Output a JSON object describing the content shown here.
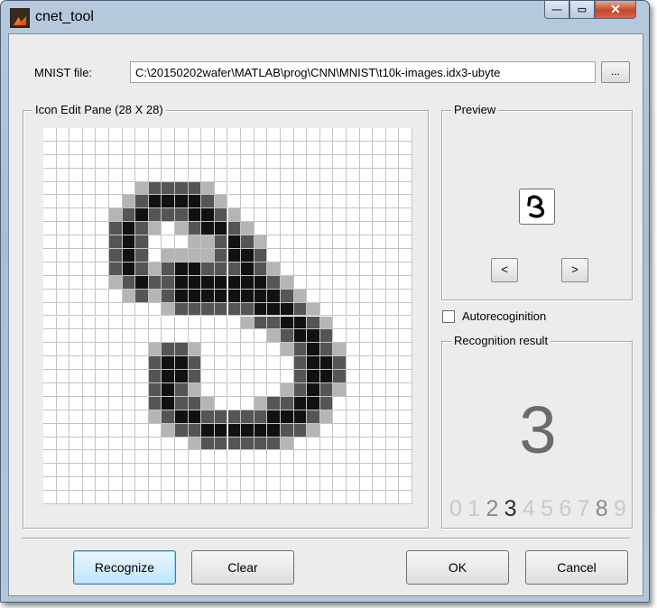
{
  "window": {
    "title": "cnet_tool"
  },
  "file": {
    "label": "MNIST file:",
    "path": "C:\\20150202wafer\\MATLAB\\prog\\CNN\\MNIST\\t10k-images.idx3-ubyte",
    "browse_label": "..."
  },
  "edit_pane": {
    "title": "Icon Edit Pane (28 X 28)",
    "rows": 28,
    "cols": 28,
    "cells": [
      "",
      "",
      "",
      "",
      "",
      "",
      "",
      "",
      "",
      "",
      "",
      "",
      "",
      "",
      "",
      "",
      "",
      "",
      "",
      "",
      "",
      "",
      "",
      "",
      "",
      "",
      "",
      ""
    ],
    "ink": [
      [
        4,
        12,
        5,
        14
      ],
      [
        5,
        11,
        6,
        13
      ],
      [
        6,
        10,
        7,
        13
      ],
      [
        7,
        10,
        8,
        18
      ],
      [
        8,
        9,
        9,
        17
      ],
      [
        9,
        9,
        10,
        19
      ],
      [
        10,
        9,
        11,
        19
      ],
      [
        11,
        9,
        12,
        20
      ],
      [
        12,
        9,
        13,
        22
      ],
      [
        13,
        9,
        14,
        23
      ],
      [
        14,
        10,
        15,
        24
      ],
      [
        15,
        10,
        16,
        25
      ],
      [
        16,
        10,
        17,
        25
      ],
      [
        17,
        9,
        18,
        26
      ],
      [
        18,
        10,
        19,
        26
      ]
    ],
    "shape": "digit-3"
  },
  "preview": {
    "title": "Preview",
    "prev_label": "<",
    "next_label": ">"
  },
  "autorecognition": {
    "label": "Autorecoginition",
    "checked": false
  },
  "result": {
    "title": "Recognition result",
    "digit": "3",
    "digits": [
      "0",
      "1",
      "2",
      "3",
      "4",
      "5",
      "6",
      "7",
      "8",
      "9"
    ],
    "selected_index": 3
  },
  "buttons": {
    "recognize": "Recognize",
    "clear": "Clear",
    "ok": "OK",
    "cancel": "Cancel"
  },
  "colors": {
    "ink_dark": "#111111",
    "ink_mid": "#555555",
    "ink_light": "#b5b5b5",
    "accent_default": "#3c7fb1"
  }
}
